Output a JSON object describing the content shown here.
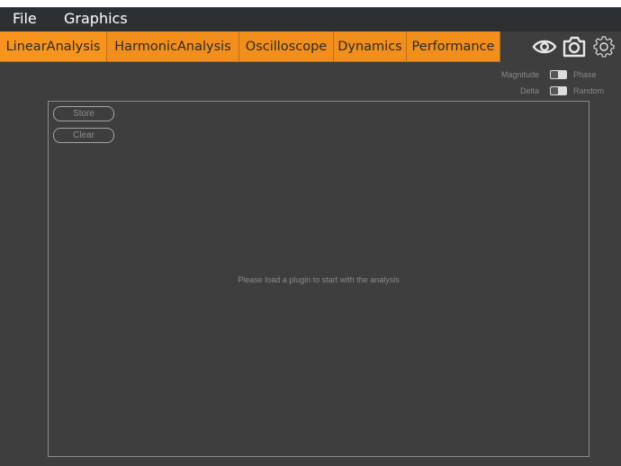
{
  "menubar": {
    "items": [
      {
        "label": "File"
      },
      {
        "label": "Graphics"
      }
    ]
  },
  "tabs": [
    {
      "label": "LinearAnalysis",
      "active": true
    },
    {
      "label": "HarmonicAnalysis",
      "active": false
    },
    {
      "label": "Oscilloscope",
      "active": false
    },
    {
      "label": "Dynamics",
      "active": false
    },
    {
      "label": "Performance",
      "active": false
    }
  ],
  "toolbar": {
    "icons": [
      "eye-icon",
      "camera-icon",
      "gear-icon"
    ]
  },
  "toggles": [
    {
      "left_label": "Magnitude",
      "right_label": "Phase"
    },
    {
      "left_label": "Delta",
      "right_label": "Random"
    }
  ],
  "plot": {
    "buttons": [
      {
        "label": "Store"
      },
      {
        "label": "Clear"
      }
    ],
    "message": "Please load a plugin to start with the analysis"
  },
  "colors": {
    "accent": "#f7941e",
    "background": "#3e3e3e",
    "menubar": "#2d3033"
  }
}
